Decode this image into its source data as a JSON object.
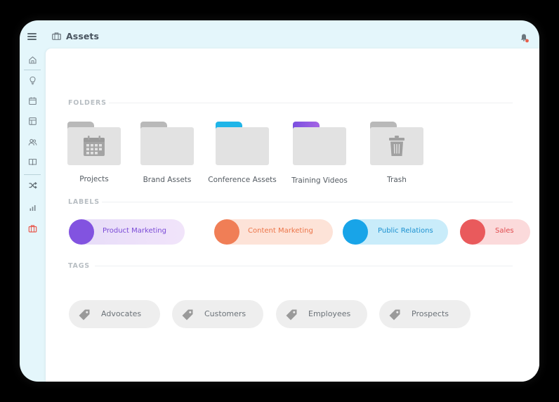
{
  "app": {
    "title": "Assets"
  },
  "sidebar": {
    "items": [
      {
        "icon": "home-icon"
      },
      {
        "icon": "lightbulb-icon"
      },
      {
        "icon": "calendar-icon"
      },
      {
        "icon": "layout-icon"
      },
      {
        "icon": "users-icon"
      },
      {
        "icon": "book-icon"
      },
      {
        "icon": "shuffle-icon"
      },
      {
        "icon": "bar-chart-icon"
      },
      {
        "icon": "briefcase-icon",
        "active": true
      }
    ]
  },
  "sections": {
    "folders": "FOLDERS",
    "labels": "LABELS",
    "tags": "TAGS"
  },
  "folders": [
    {
      "name": "Projects",
      "icon": "calendar-icon",
      "tab_color": "#b9b9b9"
    },
    {
      "name": "Brand Assets",
      "icon": "",
      "tab_color": "#b9b9b9"
    },
    {
      "name": "Conference Assets",
      "icon": "",
      "tab_color": "#1fb5e8"
    },
    {
      "name": "Training Videos",
      "icon": "",
      "tab_color": "#8a56e0"
    },
    {
      "name": "Trash",
      "icon": "trash-icon",
      "tab_color": "#b9b9b9"
    }
  ],
  "labels": [
    {
      "name": "Product Marketing",
      "dot": "#8253e0",
      "bg": "#eadcf8",
      "text_color": "#7a4ad6"
    },
    {
      "name": "Content Marketing",
      "dot": "#f07e56",
      "bg": "#fde3d8",
      "text_color": "#ec7448"
    },
    {
      "name": "Public Relations",
      "dot": "#18a4e8",
      "bg": "#c9ecfa",
      "text_color": "#1a90d0"
    },
    {
      "name": "Sales",
      "dot": "#e95a5c",
      "bg": "#fbdadb",
      "text_color": "#e14c4f"
    }
  ],
  "tags": [
    {
      "name": "Advocates",
      "icon": "tag-icon"
    },
    {
      "name": "Customers",
      "icon": "tag-icon"
    },
    {
      "name": "Employees",
      "icon": "tag-icon"
    },
    {
      "name": "Prospects",
      "icon": "tag-icon"
    }
  ],
  "colors": {
    "device_bg": "#e4f6fb",
    "accent_active": "#e85a4f",
    "notification_dot": "#e8604c"
  }
}
